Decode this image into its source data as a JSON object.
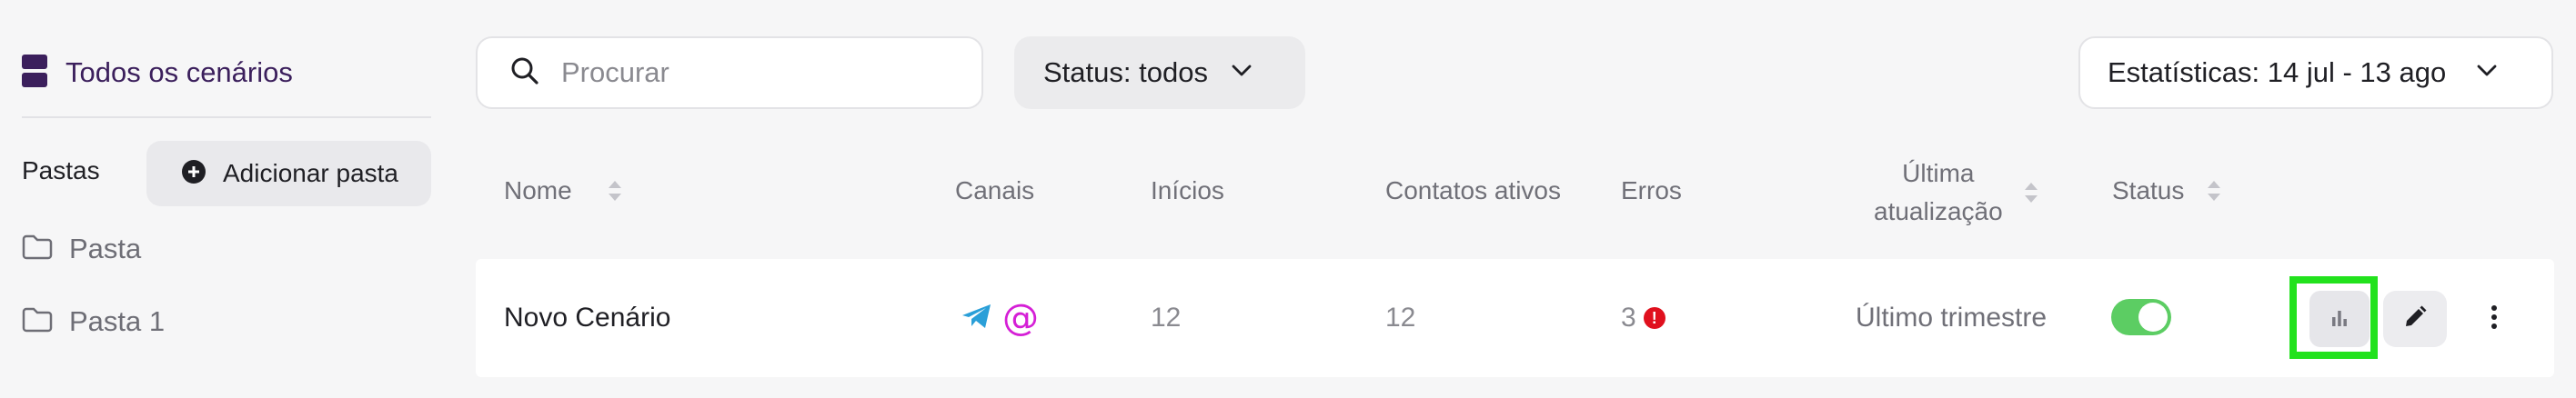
{
  "sidebar": {
    "all_scenarios": "Todos os cenários",
    "folders_label": "Pastas",
    "add_folder": "Adicionar pasta",
    "folders": [
      "Pasta",
      "Pasta 1"
    ]
  },
  "toolbar": {
    "search_placeholder": "Procurar",
    "status_filter": "Status: todos",
    "stats_range": "Estatísticas: 14 jul - 13 ago"
  },
  "table": {
    "headers": {
      "name": "Nome",
      "channels": "Canais",
      "starts": "Inícios",
      "active_contacts": "Contatos ativos",
      "errors": "Erros",
      "last_update_1": "Última",
      "last_update_2": "atualização",
      "status": "Status"
    },
    "rows": [
      {
        "name": "Novo Cenário",
        "channels": [
          "telegram-icon",
          "email-at-icon"
        ],
        "starts": "12",
        "active_contacts": "12",
        "errors": "3",
        "last_update": "Último trimestre",
        "status_on": true
      }
    ]
  },
  "colors": {
    "accent_dark": "#3b1f5c",
    "telegram": "#2a9fd8",
    "email_at": "#d51fd6",
    "toggle_on": "#5ccd63",
    "error": "#e0101e",
    "highlight": "#22e21d"
  }
}
